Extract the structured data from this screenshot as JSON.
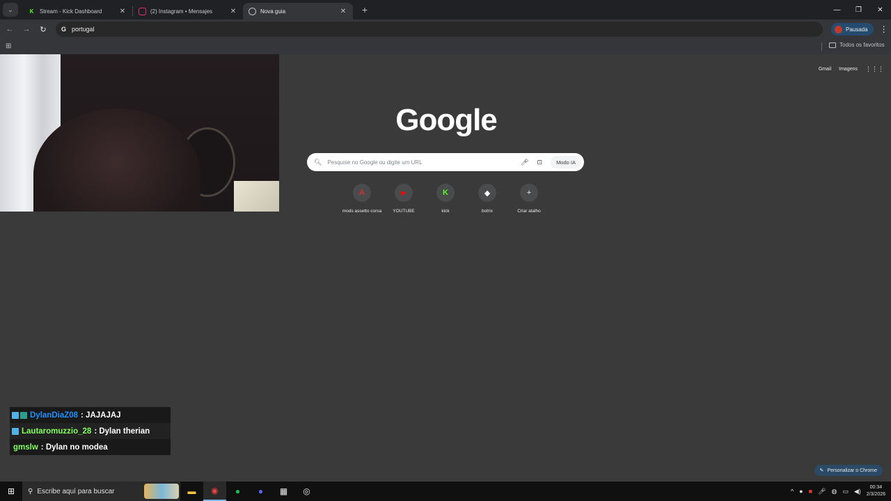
{
  "browser": {
    "tabs": [
      {
        "title": "Stream - Kick Dashboard",
        "favicon": "kick-icon",
        "color": "#53fc18",
        "active": false
      },
      {
        "title": "(2) Instagram • Mensajes",
        "favicon": "instagram-icon",
        "color": "#e1306c",
        "active": false
      },
      {
        "title": "Nova guia",
        "favicon": "chrome-icon",
        "color": "#bdc1c6",
        "active": true
      }
    ],
    "address": "portugal",
    "profile_label": "Pausada",
    "all_favorites": "Todos os favoritos"
  },
  "page": {
    "top_links": [
      "Gmail",
      "Imagens"
    ],
    "logo": "Google",
    "search_placeholder": "Pesquise no Google ou digite um URL",
    "mode_button": "Modo IA",
    "shortcuts": [
      {
        "label": "mods assetto corsa",
        "icon": "assetto-corsa-icon",
        "glyph": "A",
        "color": "#d32f2f"
      },
      {
        "label": "YOUTUBE",
        "icon": "youtube-icon",
        "glyph": "▶",
        "color": "#ff0000"
      },
      {
        "label": "kick",
        "icon": "kick-icon",
        "glyph": "K",
        "color": "#53fc18"
      },
      {
        "label": "botrix",
        "icon": "botrix-icon",
        "glyph": "◆",
        "color": "#ffffff"
      },
      {
        "label": "Criar atalho",
        "icon": "plus-icon",
        "glyph": "+",
        "color": "#e8eaed"
      }
    ],
    "customize_label": "Personalizar o Chrome"
  },
  "chat": {
    "messages": [
      {
        "user": "DylanDiaZ08",
        "text": ": JAJAJAJ",
        "color": "#1e90ff",
        "badges": 2
      },
      {
        "user": "Lautaromuzzio_28",
        "text": ": Dylan therian",
        "color": "#7fff5a",
        "badges": 1
      },
      {
        "user": "gmslw",
        "text": ": Dylan no modea",
        "color": "#7fff5a",
        "badges": 0
      }
    ]
  },
  "taskbar": {
    "search_placeholder": "Escribe aquí para buscar",
    "time": "00:34",
    "date": "2/3/2026"
  }
}
